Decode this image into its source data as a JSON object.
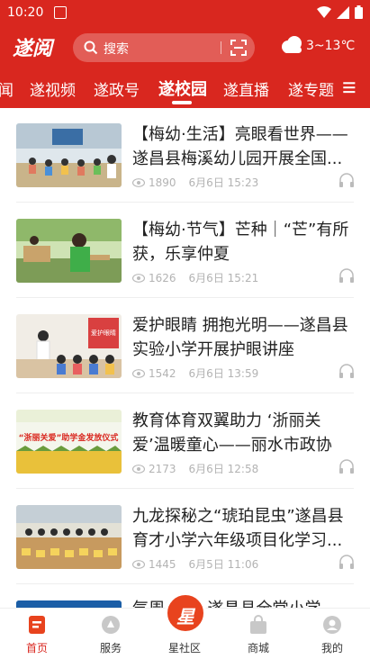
{
  "status_bar": {
    "time": "10:20"
  },
  "header": {
    "logo": "遂阅",
    "search_placeholder": "搜索",
    "weather": "3~13℃"
  },
  "tabs": [
    {
      "label": "闻"
    },
    {
      "label": "遂视频"
    },
    {
      "label": "遂政号"
    },
    {
      "label": "遂校园",
      "active": true
    },
    {
      "label": "遂直播"
    },
    {
      "label": "遂专题"
    }
  ],
  "news": [
    {
      "title": "【梅幼·生活】亮眼看世界——遂昌县梅溪幼儿园开展全国...",
      "views": "1890",
      "date": "6月6日 15:23"
    },
    {
      "title": "【梅幼·节气】芒种｜“芒”有所获，乐享仲夏",
      "views": "1626",
      "date": "6月6日 15:21"
    },
    {
      "title": "爱护眼睛 拥抱光明——遂昌县实验小学开展护眼讲座",
      "views": "1542",
      "date": "6月6日 13:59"
    },
    {
      "title": "教育体育双翼助力 ‘浙丽关爱’温暖童心——丽水市政协走...",
      "views": "2173",
      "date": "6月6日 12:58"
    },
    {
      "title": "九龙探秘之“琥珀昆虫”遂昌县育才小学六年级项目化学习...",
      "views": "1445",
      "date": "6月5日 11:06"
    },
    {
      "title": "气周 全谱 遂昌县全堂小学",
      "views": "",
      "date": ""
    }
  ],
  "thumb_texts": {
    "item3_banner": "爱护眼睛",
    "item4_banner": "“浙丽关爱”助学金发放仪式"
  },
  "bottom_nav": [
    {
      "label": "首页",
      "active": true
    },
    {
      "label": "服务"
    },
    {
      "label": "星社区",
      "glyph": "星"
    },
    {
      "label": "商城"
    },
    {
      "label": "我的"
    }
  ],
  "colors": {
    "brand_red": "#d9271f",
    "accent_orange": "#e8431e"
  }
}
